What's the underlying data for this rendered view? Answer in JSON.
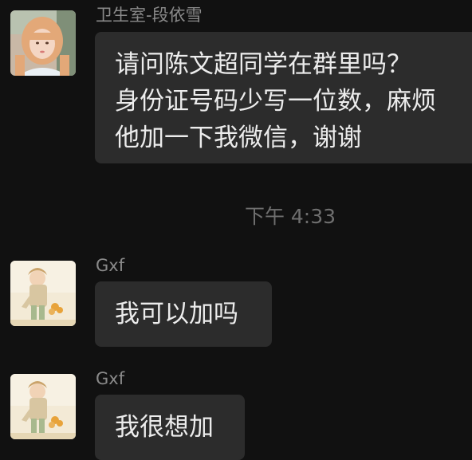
{
  "messages": [
    {
      "sender": "卫生室-段依雪",
      "lines": [
        "请问陈文超同学在群里吗？",
        "身份证号码少写一位数，麻烦",
        "他加一下我微信，谢谢"
      ],
      "avatar_icon": "woman-portrait-avatar"
    },
    {
      "sender": "Gxf",
      "lines": [
        "我可以加吗"
      ],
      "avatar_icon": "anime-character-avatar"
    },
    {
      "sender": "Gxf",
      "lines": [
        "我很想加"
      ],
      "avatar_icon": "anime-character-avatar"
    }
  ],
  "time_divider": "下午 4:33",
  "colors": {
    "background": "#111111",
    "bubble": "#2c2c2c",
    "bubble_text": "#ececec",
    "sender_text": "#8a8a8a",
    "time_text": "#6f6f6f"
  }
}
